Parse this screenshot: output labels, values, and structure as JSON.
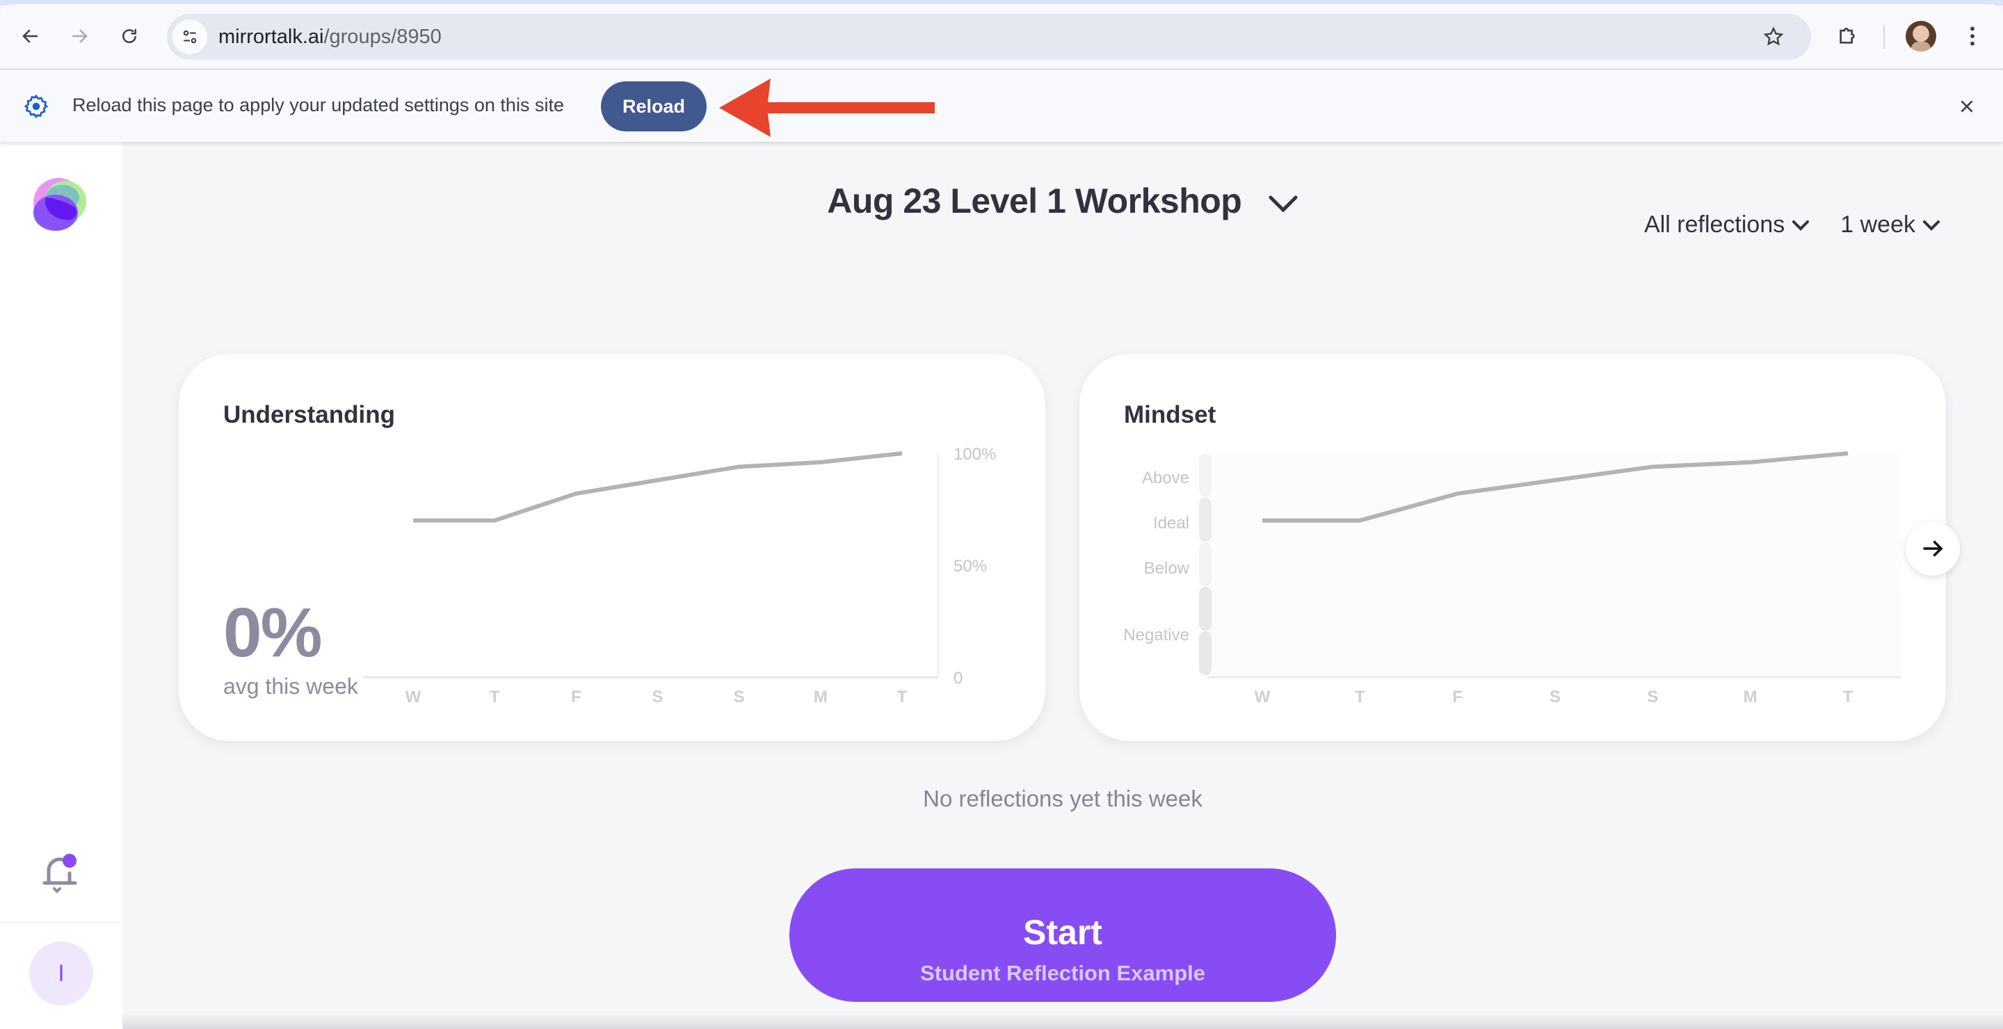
{
  "browser": {
    "url_host": "mirrortalk.ai",
    "url_path": "/groups/8950",
    "icons": [
      "back-arrow-icon",
      "forward-arrow-icon",
      "reload-icon",
      "site-settings-icon",
      "bookmark-star-icon",
      "extensions-puzzle-icon",
      "profile-avatar",
      "more-menu-icon"
    ]
  },
  "infobar": {
    "message": "Reload this page to apply your updated settings on this site",
    "reload_label": "Reload",
    "annotation": "red-arrow-pointing-to-reload"
  },
  "sidebar": {
    "logo": "mirrortalk-logo",
    "notification_badge": true,
    "avatar_initial": "I"
  },
  "header": {
    "group_title": "Aug 23 Level 1 Workshop",
    "filter_reflections": "All reflections",
    "filter_period": "1 week"
  },
  "understanding": {
    "title": "Understanding",
    "avg_value": "0%",
    "avg_label": "avg this week"
  },
  "mindset": {
    "title": "Mindset"
  },
  "empty_message": "No reflections yet this week",
  "start_button": {
    "label": "Start",
    "sublabel": "Student Reflection Example"
  },
  "colors": {
    "accent": "#874cf4",
    "reload_button": "#41598f",
    "annotation_arrow": "#e8432b",
    "placeholder_line": "#b3b3b3"
  },
  "chart_data": [
    {
      "type": "line",
      "title": "Understanding",
      "categories": [
        "W",
        "T",
        "F",
        "S",
        "S",
        "M",
        "T"
      ],
      "values": [
        70,
        70,
        82,
        88,
        94,
        96,
        100
      ],
      "ylabel": "",
      "xlabel": "",
      "ylim": [
        0,
        100
      ],
      "yticks": [
        "0",
        "50%",
        "100%"
      ],
      "ytick_values": [
        0,
        50,
        100
      ],
      "y_axis_position": "right",
      "grid": false,
      "note": "grey placeholder line"
    },
    {
      "type": "line",
      "title": "Mindset",
      "categories": [
        "W",
        "T",
        "F",
        "S",
        "S",
        "M",
        "T"
      ],
      "values": [
        70,
        70,
        82,
        88,
        94,
        96,
        100
      ],
      "ylim": [
        0,
        100
      ],
      "y_bands": [
        "Above",
        "Ideal",
        "Below",
        "Negative"
      ],
      "y_axis_position": "left",
      "grid": false,
      "note": "grey placeholder line"
    }
  ]
}
